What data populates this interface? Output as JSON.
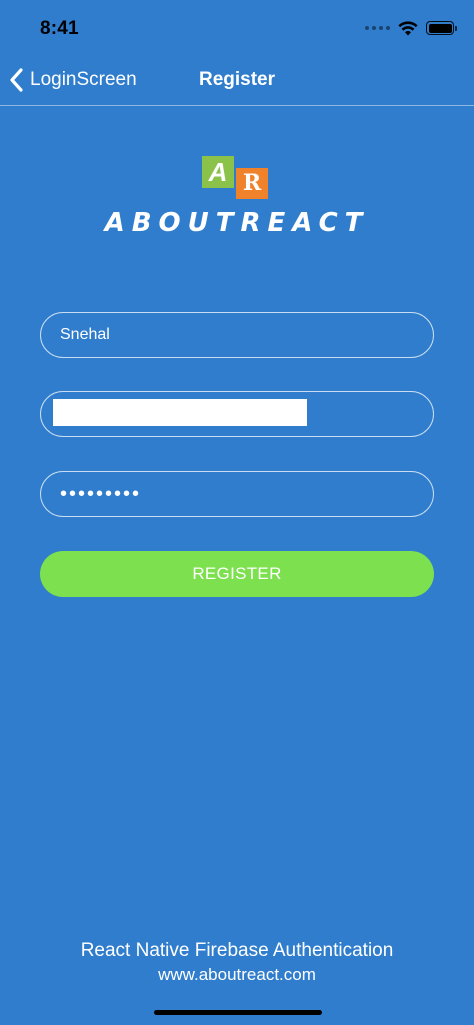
{
  "status_bar": {
    "time": "8:41",
    "wifi_icon": "wifi-icon",
    "battery_icon": "battery-full-icon"
  },
  "nav": {
    "back_label": "LoginScreen",
    "back_icon": "chevron-left-icon",
    "title": "Register"
  },
  "logo": {
    "mark_a": "A",
    "mark_r": "R",
    "text": "ABOUTREACT",
    "colors": {
      "a_bg": "#8bc34a",
      "r_bg": "#f0822b"
    }
  },
  "form": {
    "name_value": "Snehal",
    "email_value": "",
    "password_value": "•••••••••",
    "register_label": "REGISTER"
  },
  "footer": {
    "title": "React Native Firebase Authentication",
    "url": "www.aboutreact.com"
  },
  "theme": {
    "background": "#2f7dcc",
    "button": "#7de04f",
    "text": "#ffffff"
  }
}
